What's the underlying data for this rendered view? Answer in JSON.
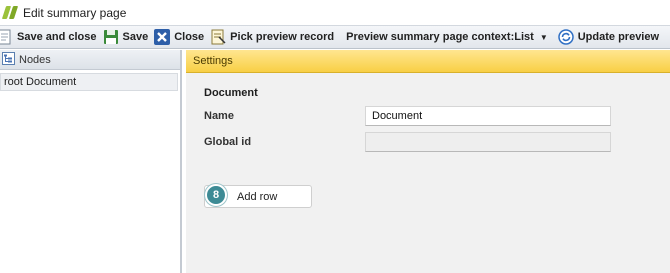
{
  "window": {
    "title": "Edit summary page"
  },
  "toolbar": {
    "save_and_close": "Save and close",
    "save": "Save",
    "close": "Close",
    "pick_preview_record": "Pick preview record",
    "preview_context": "Preview summary page context:List",
    "update_preview": "Update preview"
  },
  "nodes_panel": {
    "header": "Nodes",
    "items": [
      "root Document"
    ]
  },
  "settings": {
    "header": "Settings",
    "section_title": "Document",
    "name_label": "Name",
    "name_value": "Document",
    "global_id_label": "Global id",
    "global_id_value": "",
    "add_row_label": "Add row",
    "step_badge": "8"
  },
  "colors": {
    "settings_header": "#f8cf45",
    "step_badge": "#3d8b95",
    "logo": "#9bc23b"
  }
}
